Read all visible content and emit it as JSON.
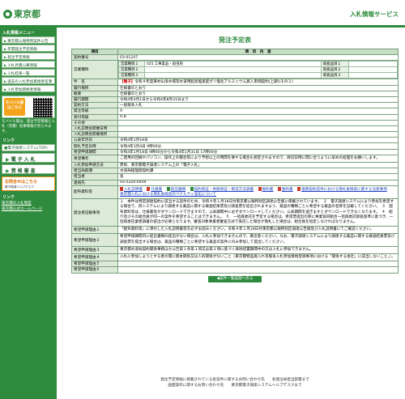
{
  "header": {
    "logo_text": "東京都",
    "system_title": "入札情報サービス"
  },
  "sidebar": {
    "section_menu": "入札情報メニュー",
    "menu_items": [
      "東京都公報特例案件公告",
      "年間発注予定情報",
      "発注予定情報",
      "入札見積公募情報",
      "入札結果一覧",
      "過去の入札参加資格者名簿",
      "入札参加資格者情報"
    ],
    "mobile_label": "モバイル版",
    "mobile_sub": "はこちら",
    "mobile_note": "モバイル版は、発注予定情報と入札（見積）結果情報が見られます。",
    "section_links": "リンク",
    "links": [
      "電子調達システム(TOP)"
    ],
    "big_items": [
      "電子入札",
      "資格審査"
    ],
    "contact_title": "お問合せはこちら",
    "contact_sub": "電子調達ヘルプデスク",
    "section_other": "リンク",
    "ext_links": [
      "東京都の入札制度",
      "東京都公式ホームページ"
    ]
  },
  "main": {
    "page_title": "発注予定表",
    "col_item": "項目",
    "col_content": "項　目　内　容",
    "contract_no_label": "契約番号",
    "contract_no": "03-01247",
    "business_label": "営業種目",
    "business_rows": [
      {
        "k": "営業種目１",
        "v": "025 工事業品・殺虫剤",
        "rk": "取扱品目１",
        "rv": ""
      },
      {
        "k": "営業種目２",
        "v": "",
        "rk": "取扱品目２",
        "rv": ""
      },
      {
        "k": "営業種目３",
        "v": "",
        "rk": "取扱品目３",
        "rv": ""
      }
    ],
    "subject_label": "件　名",
    "subject_tag": "【電子】",
    "subject": "令和４年度東村山浄水場等水道用超高塩基度ポリ塩化アルミニウム買入単価契約(上期)(その２)",
    "rows1": [
      {
        "k": "履行場所",
        "v": "仕様書のとおり"
      },
      {
        "k": "概要",
        "v": "仕様書のとおり"
      },
      {
        "k": "履行期間",
        "v": "令和4年4月1日から令和4年8月31日まで"
      },
      {
        "k": "契約方法",
        "v": "一般競争入札"
      },
      {
        "k": "発注等級",
        "v": "A"
      },
      {
        "k": "受付等級",
        "v": "A,B"
      },
      {
        "k": "その他",
        "v": ""
      },
      {
        "k": "入札説明会開催日時",
        "v": ""
      },
      {
        "k": "入札説明会開催場所",
        "v": ""
      },
      {
        "k": "公表年月日",
        "v": "令和4年1月18日"
      },
      {
        "k": "開札予定日時",
        "v": "令和4年3月4日 9時00分"
      },
      {
        "k": "希望申請期間",
        "v": "令和4年1月18日 9時00分から令和4年1月31日 17時00分"
      }
    ],
    "hope_label": "希望備考",
    "hope_text": "ご使用の回線やパソコン、操作上の都合等により予想以上の時間を要する場合も想定されますので、締切日時に間に合うように早めの処理をお願いします。",
    "rows2": [
      {
        "k": "入札参加申請方法",
        "v": "原則、東京都電子調達システム上の「電子入札」"
      },
      {
        "k": "担当局部課",
        "v": "水道局経理部契約課"
      },
      {
        "k": "担当者",
        "v": "島"
      },
      {
        "k": "連絡先",
        "v": "03-5320-6404"
      }
    ],
    "docs_label": "配布資料等",
    "doc_links": [
      "入札説明書",
      "仕様書",
      "提出書類",
      "契約保証・供給保証・製造方法調書",
      "誓約書",
      "誓約書",
      "連携契約案件における落札後辞退に関する注意事項"
    ],
    "doc_note": "東京都入札における落札後辞退のペナルティ強化について",
    "notes_label": "発注者記載事項",
    "notes_text": "１　本件は特定調達契約に該当する案件のため、令和４年１月18日付東京都公報特別区調達公告版に掲載されています。　２　電子調達システムにより参加を希望する場合で、同システムにより調達する薬品に関する検査結果票及び調査票を提出されますよう、薬品の種類ごとに希望する薬品の名称を記載してください。　３　配布資料等は、仕様書等がダウンロードできますので、公表期間中に必ずダウンロードしてください。公表期間を過ぎますとダウンロードできなくなります。　４　紹介及びその組合員が同一の案件を希望することはできません。　５　一括再委託を予定する場合は、希望票提出の際に事業協同組合一括再委託取扱基準に基づき、一括再委託業者調書の提出が必要となります。審査対象事業者審査方式で受託した場合が落札した場合は、組合員を指定しなければなりません。",
    "ext1_label": "希望申請理由１",
    "ext1_text": "「配布資料等」に添付した入札説明書等を必ずお読みください。令和４年１月18日付東京都公報特別区調達公告版及び入札説明書にてご確認ください。",
    "ext2_label": "希望申請理由２",
    "ext2_text": "希望申請期間内に提出書類の提出がない場合は、入札に参加できませんので、御注意ください。なお、電子調達システムにより調達する薬品に関する検査結果票及び調査票を提出する場合は、薬品の種類ごとに希望する薬品の案件にのみ参加して提出してください。",
    "ext3_label": "希望申請理由３",
    "ext3_text": "東京都水道局契約関係事務ほか公告第１条第１項又は第２項に基づく排除措置期間中の方は入札に参加できません。",
    "ext4_label": "希望申請理由４",
    "ext4_text": "入札に参加しようとする者の間に資本関係又は人的関係がないこと（東京都物品買入れ等競争入札参加資格登録事項における「関係する会社」に該当しないこと。）。",
    "ext5_label": "希望申請理由５",
    "ext6_label": "希望申請理由６",
    "back_button": "案件一覧画面へ戻る"
  },
  "footer": {
    "line1": "発注予定情報に掲載されている各案件に関するお問い合わせ先　　各発注局担当部署まで",
    "line2": "画面操作に関するお問い合わせ先　　東京都電子調達システムヘルプデスクまで"
  }
}
